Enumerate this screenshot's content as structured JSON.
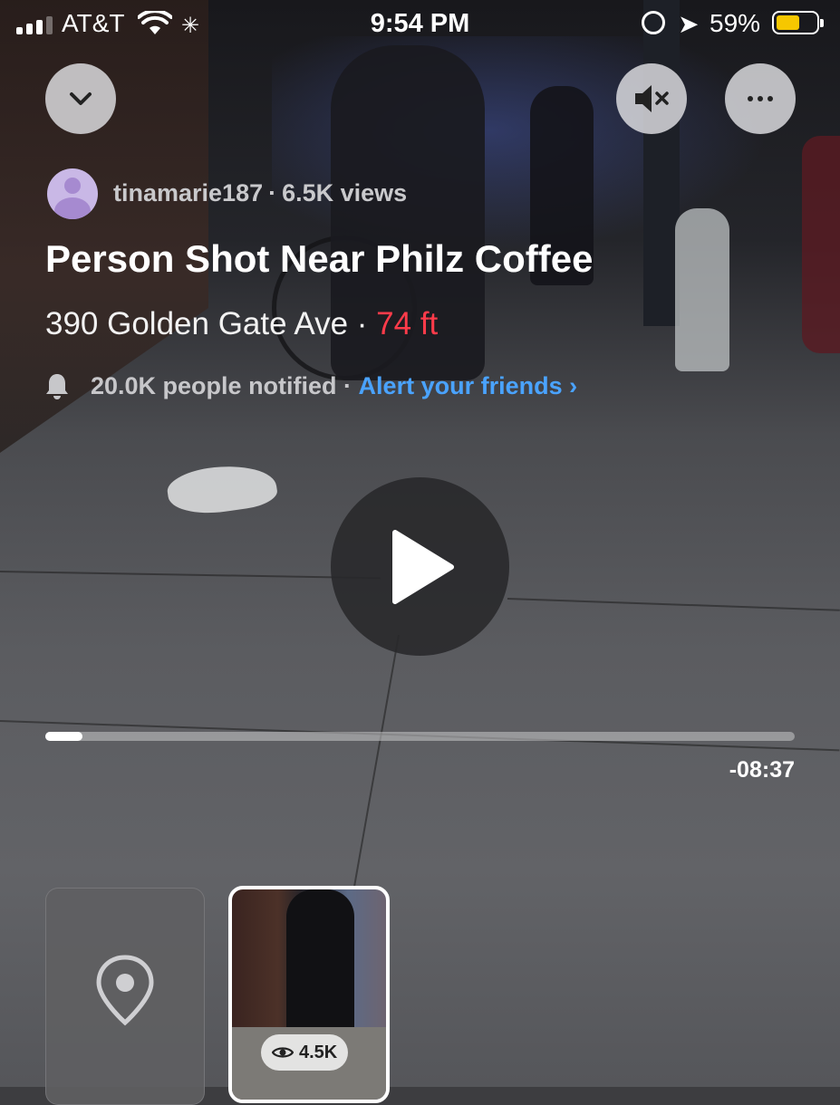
{
  "status_bar": {
    "carrier": "AT&T",
    "time": "9:54 PM",
    "battery_percent": "59%",
    "battery_level": 0.59,
    "signal_bars_active": 3,
    "battery_color": "#f6c700"
  },
  "post": {
    "username": "tinamarie187",
    "views": "6.5K views",
    "title": "Person Shot Near Philz Coffee",
    "address": "390 Golden Gate Ave",
    "distance": "74 ft",
    "notified": "20.0K people notified",
    "alert_link": "Alert your friends ›"
  },
  "player": {
    "time_remaining": "-08:37",
    "progress": 0.05
  },
  "thumbnails": [
    {
      "type": "map",
      "icon": "map-pin-icon"
    },
    {
      "type": "video",
      "views": "4.5K",
      "icon": "eye-icon"
    }
  ],
  "icons": {
    "back": "chevron-down-icon",
    "mute": "speaker-muted-icon",
    "more": "more-icon",
    "notified": "bell-icon",
    "play": "play-icon"
  },
  "colors": {
    "distance": "#ff3b4a",
    "link": "#4aa3ff"
  }
}
